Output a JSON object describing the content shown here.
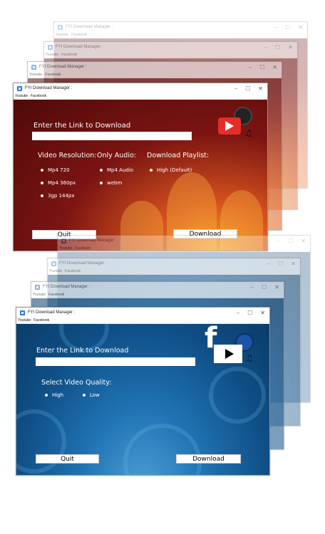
{
  "window": {
    "title": "FYI Download Manager :"
  },
  "menu": [
    "Youtube",
    "Facebook"
  ],
  "controls": {
    "min": "–",
    "max": "☐",
    "close": "✕"
  },
  "youtube_app": {
    "prompt": "Enter the Link to Download",
    "video_heading": "Video Resolution:",
    "audio_heading": "Only Audio:",
    "playlist_heading": "Download Playlist:",
    "video_options": [
      "Mp4 720",
      "Mp4 360px",
      "3gp 144px"
    ],
    "audio_options": [
      "Mp4 Audio",
      "webm"
    ],
    "playlist_options": [
      "High (Default)"
    ],
    "quit": "Quit",
    "download": "Download"
  },
  "facebook_app": {
    "prompt": "Enter the Link to Download",
    "quality_heading": "Select Video Quality:",
    "quality_options": [
      "High",
      "Low"
    ],
    "quit": "Quit",
    "download": "Download"
  },
  "colors": {
    "red_theme": "#7b1412",
    "blue_theme": "#0f4f86",
    "youtube_red": "#e52d27",
    "facebook_icon": "#ffffff"
  },
  "icons": [
    "youtube-icon",
    "facebook-icon",
    "music-disc-icon",
    "music-notes-icon"
  ]
}
